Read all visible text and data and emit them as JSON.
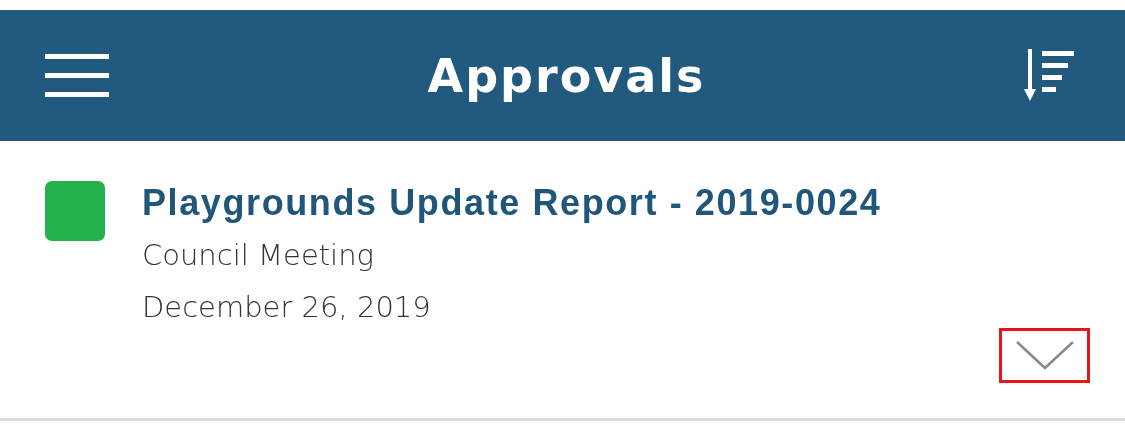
{
  "header": {
    "title": "Approvals"
  },
  "items": [
    {
      "title": "Playgrounds Update Report - 2019-0024",
      "color": "#22b14c",
      "subtitle": "Council Meeting",
      "date": "December 26, 2019",
      "expanded": false,
      "highlighted": true
    }
  ]
}
